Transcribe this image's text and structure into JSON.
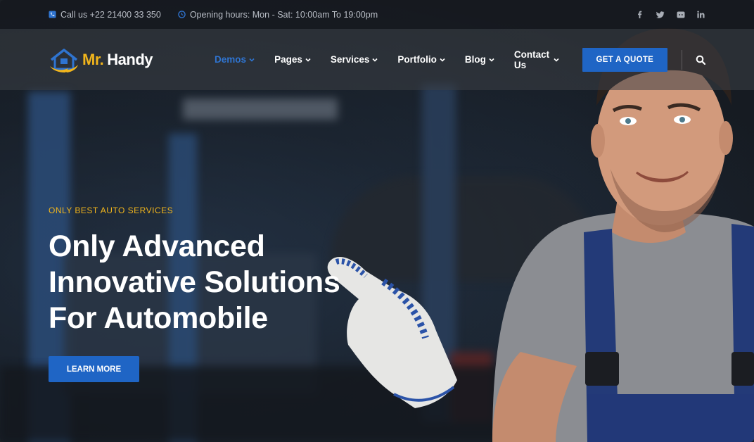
{
  "topbar": {
    "phone_text": "Call us +22 21400 33 350",
    "hours_text": "Opening hours: Mon - Sat: 10:00am To 19:00pm",
    "phone_icon": "phone-icon",
    "hours_icon": "clock-icon",
    "socials": [
      "facebook-icon",
      "twitter-icon",
      "discord-icon",
      "linkedin-icon"
    ]
  },
  "header": {
    "logo_mr": "Mr.",
    "logo_handy": "Handy",
    "nav": [
      {
        "label": "Demos",
        "active": true
      },
      {
        "label": "Pages",
        "active": false
      },
      {
        "label": "Services",
        "active": false
      },
      {
        "label": "Portfolio",
        "active": false
      },
      {
        "label": "Blog",
        "active": false
      },
      {
        "label": "Contact Us",
        "active": false
      }
    ],
    "quote_label": "GET A QUOTE",
    "search_icon": "search-icon"
  },
  "hero": {
    "eyebrow": "ONLY BEST AUTO SERVICES",
    "title_lines": [
      "Only Advanced",
      "Innovative Solutions",
      "For Automobile"
    ],
    "cta_label": "LEARN MORE"
  },
  "colors": {
    "accent_blue": "#1f65c5",
    "active_nav": "#2f74d0",
    "accent_gold": "#f1b51c"
  }
}
